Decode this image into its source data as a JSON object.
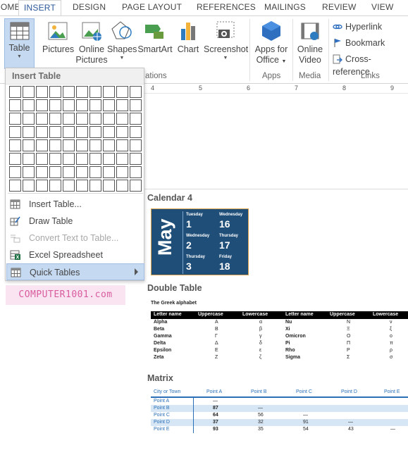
{
  "ribbon_tabs": [
    {
      "label": "HOME"
    },
    {
      "label": "INSERT"
    },
    {
      "label": "DESIGN"
    },
    {
      "label": "PAGE LAYOUT"
    },
    {
      "label": "REFERENCES"
    },
    {
      "label": "MAILINGS"
    },
    {
      "label": "REVIEW"
    },
    {
      "label": "VIEW"
    }
  ],
  "ribbon": {
    "table": "Table",
    "pictures": "Pictures",
    "online_pictures_1": "Online",
    "online_pictures_2": "Pictures",
    "shapes": "Shapes",
    "smartart": "SmartArt",
    "chart": "Chart",
    "screenshot": "Screenshot",
    "apps_office_1": "Apps for",
    "apps_office_2": "Office",
    "online_video_1": "Online",
    "online_video_2": "Video",
    "hyperlink": "Hyperlink",
    "bookmark": "Bookmark",
    "cross_reference": "Cross-reference",
    "group_illustrations": "ations",
    "group_apps": "Apps",
    "group_media": "Media",
    "group_links": "Links"
  },
  "ruler_numbers": [
    "4",
    "5",
    "6",
    "7",
    "8",
    "9"
  ],
  "menu": {
    "header": "Insert Table",
    "grid_cols": 10,
    "grid_rows": 8,
    "items": [
      {
        "label": "Insert Table...",
        "disabled": false
      },
      {
        "label": "Draw Table",
        "disabled": false
      },
      {
        "label": "Convert Text to Table...",
        "disabled": true
      },
      {
        "label": "Excel Spreadsheet",
        "disabled": false
      },
      {
        "label": "Quick Tables",
        "disabled": false
      }
    ]
  },
  "watermark": "COMPUTER1001.com",
  "gallery": {
    "calendar": {
      "title": "Calendar 4",
      "month": "May",
      "days": [
        {
          "name": "Tuesday",
          "num": "1"
        },
        {
          "name": "Wednesday",
          "num": "16"
        },
        {
          "name": "Wednesday",
          "num": "2"
        },
        {
          "name": "Thursday",
          "num": "17"
        },
        {
          "name": "Thursday",
          "num": "3"
        },
        {
          "name": "Friday",
          "num": "18"
        }
      ]
    },
    "double_table": {
      "title": "Double Table",
      "subtitle": "The Greek alphabet",
      "headers": [
        "Letter name",
        "Uppercase",
        "Lowercase",
        "Letter name",
        "Uppercase",
        "Lowercase"
      ],
      "rows": [
        [
          "Alpha",
          "Α",
          "α",
          "Nu",
          "Ν",
          "ν"
        ],
        [
          "Beta",
          "Β",
          "β",
          "Xi",
          "Ξ",
          "ξ"
        ],
        [
          "Gamma",
          "Γ",
          "γ",
          "Omicron",
          "Ο",
          "ο"
        ],
        [
          "Delta",
          "Δ",
          "δ",
          "Pi",
          "Π",
          "π"
        ],
        [
          "Epsilon",
          "Ε",
          "ε",
          "Rho",
          "Ρ",
          "ρ"
        ],
        [
          "Zeta",
          "Ζ",
          "ζ",
          "Sigma",
          "Σ",
          "σ"
        ]
      ]
    },
    "matrix": {
      "title": "Matrix",
      "headers": [
        "City or Town",
        "Point A",
        "Point B",
        "Point C",
        "Point D",
        "Point E"
      ],
      "rows": [
        [
          "Point A",
          "—",
          "",
          "",
          "",
          ""
        ],
        [
          "Point B",
          "87",
          "—",
          "",
          "",
          ""
        ],
        [
          "Point C",
          "64",
          "56",
          "—",
          "",
          ""
        ],
        [
          "Point D",
          "37",
          "32",
          "91",
          "—",
          ""
        ],
        [
          "Point E",
          "93",
          "35",
          "54",
          "43",
          "—"
        ]
      ]
    }
  },
  "colors": {
    "accent": "#2b579a",
    "hover": "#c5d9f1",
    "calendar_bg": "#1f4e79",
    "matrix_header": "#2a6fb7"
  }
}
